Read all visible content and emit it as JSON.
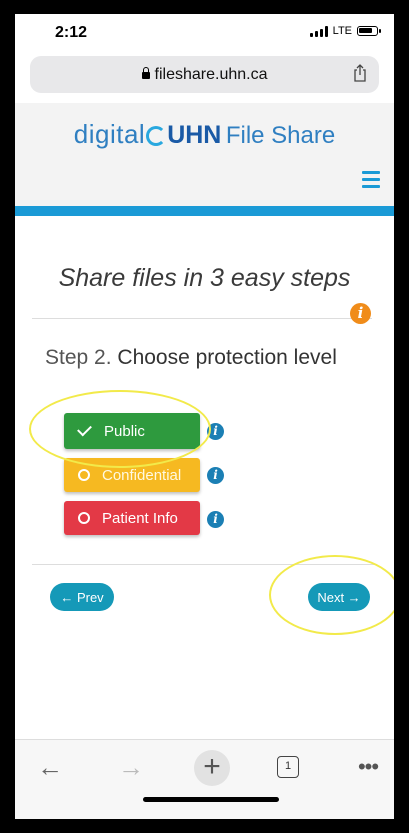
{
  "status_bar": {
    "time": "2:12",
    "network": "LTE"
  },
  "browser": {
    "url": "fileshare.uhn.ca"
  },
  "site": {
    "logo": {
      "part1": "digital",
      "part2": "UHN",
      "part3": "File Share"
    }
  },
  "main": {
    "heading": "Share files in 3 easy steps",
    "info_glyph": "i",
    "step_prefix": "Step 2.",
    "step_title": "Choose protection level",
    "levels": [
      {
        "label": "Public",
        "selected": true,
        "color": "#2e9a3e"
      },
      {
        "label": "Confidential",
        "selected": false,
        "color": "#f6b921"
      },
      {
        "label": "Patient Info",
        "selected": false,
        "color": "#e33946"
      }
    ],
    "prev_label": "← Prev",
    "next_label": "Next →"
  },
  "toolbar": {
    "back_glyph": "←",
    "forward_glyph": "→",
    "new_tab_glyph": "+",
    "tab_count": "1",
    "more_glyph": "•••"
  },
  "colors": {
    "accent": "#1a9ad6",
    "button_teal": "#1599b8",
    "highlight": "#f2ea4a"
  }
}
